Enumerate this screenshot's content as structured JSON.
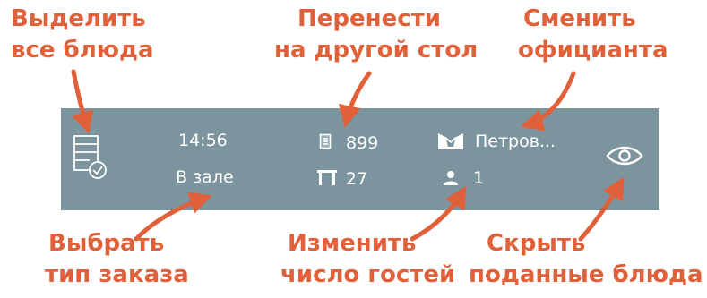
{
  "callouts": {
    "select_all": [
      "Выделить",
      "все блюда"
    ],
    "move_table": [
      "Перенести",
      "на другой стол"
    ],
    "change_waiter": [
      "Сменить",
      "официанта"
    ],
    "order_type": [
      "Выбрать",
      "тип заказа"
    ],
    "guests": [
      "Изменить",
      "число гостей"
    ],
    "hide_served": [
      "Скрыть",
      "поданные блюда"
    ]
  },
  "toolbar": {
    "time": "14:56",
    "order_type": "В зале",
    "order_number": "899",
    "table_number": "27",
    "waiter": "Петров...",
    "guests": "1"
  },
  "icons": {
    "select_all": "checklist-icon",
    "order": "receipt-icon",
    "table": "table-icon",
    "waiter": "waiter-icon",
    "guests": "person-icon",
    "hide": "eye-icon"
  },
  "colors": {
    "accent": "#e0603a",
    "toolbar_bg": "#7b949e",
    "toolbar_text": "#ffffff"
  }
}
